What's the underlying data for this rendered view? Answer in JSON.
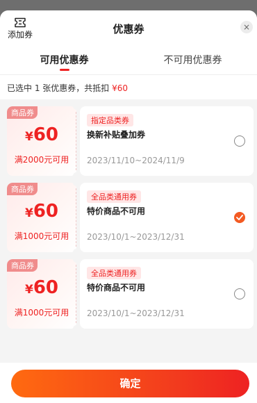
{
  "header": {
    "add_label": "添加券",
    "title": "优惠券",
    "close_glyph": "×"
  },
  "tabs": [
    {
      "label": "可用优惠券",
      "active": true
    },
    {
      "label": "不可用优惠券",
      "active": false
    }
  ],
  "summary": {
    "text": "已选中 1 张优惠券，共抵扣 ",
    "amount": "¥60"
  },
  "coupons": [
    {
      "tag": "商品券",
      "currency": "¥",
      "value": "60",
      "condition": "满2000元可用",
      "category": "指定品类券",
      "name": "换新补贴叠加券",
      "date": "2023/11/10~2024/11/9",
      "selected": false
    },
    {
      "tag": "商品券",
      "currency": "¥",
      "value": "60",
      "condition": "满1000元可用",
      "category": "全品类通用券",
      "name": "特价商品不可用",
      "date": "2023/10/1~2023/12/31",
      "selected": true
    },
    {
      "tag": "商品券",
      "currency": "¥",
      "value": "60",
      "condition": "满1000元可用",
      "category": "全品类通用券",
      "name": "特价商品不可用",
      "date": "2023/10/1~2023/12/31",
      "selected": false
    }
  ],
  "footer": {
    "confirm_label": "确定"
  },
  "colors": {
    "accent": "#ee2222",
    "check": "#f35a22",
    "button_start": "#ff6a10",
    "button_end": "#ee2222"
  },
  "icons": {
    "add": "ticket-icon",
    "close": "close-icon",
    "check": "check-icon"
  }
}
